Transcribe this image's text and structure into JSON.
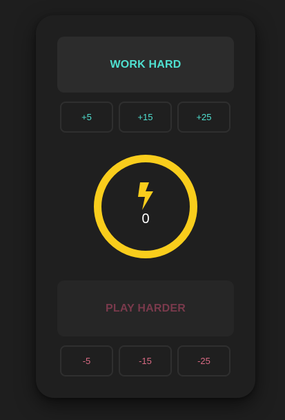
{
  "work": {
    "label": "WORK HARD",
    "increments": [
      "+5",
      "+15",
      "+25"
    ]
  },
  "meter": {
    "icon": "lightning-bolt-icon",
    "value": "0"
  },
  "play": {
    "label": "PLAY HARDER",
    "decrements": [
      "-5",
      "-15",
      "-25"
    ]
  },
  "colors": {
    "background": "#1e1e1e",
    "panel": "#1f1f1f",
    "accent_positive": "#4fe0d0",
    "accent_negative": "#d86a83",
    "play_label": "#7a3a4c",
    "ring": "#f9cd1c",
    "counter_text": "#ffffff"
  }
}
